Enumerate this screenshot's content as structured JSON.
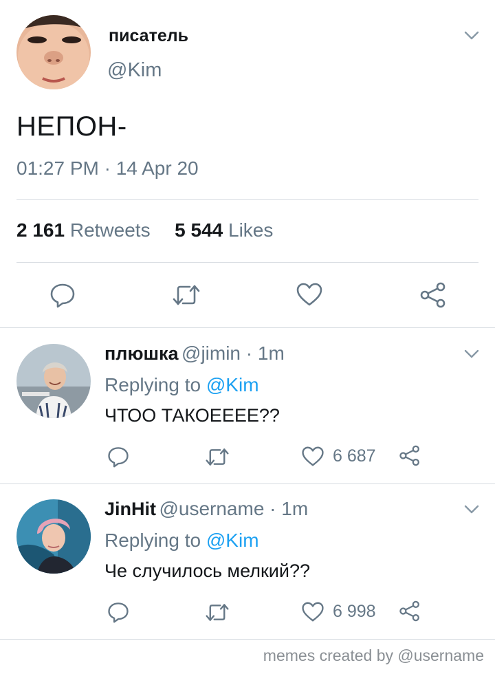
{
  "main_tweet": {
    "author_name": "писатель",
    "author_handle": "@Kim",
    "text": "НЕПОН-",
    "timestamp": "01:27 PM · 14 Apr 20",
    "retweets_count": "2 161",
    "retweets_label": "Retweets",
    "likes_count": "5 544",
    "likes_label": "Likes"
  },
  "replies": [
    {
      "author_name": "плюшка",
      "meta": "@jimin · 1m",
      "replying_prefix": "Replying to",
      "replying_mention": "@Kim",
      "text": "ЧТОО ТАКОЕЕЕЕ??",
      "likes": "6 687"
    },
    {
      "author_name": "JinHit",
      "meta": "@username · 1m",
      "replying_prefix": "Replying to",
      "replying_mention": "@Kim",
      "text": "Че случилось мелкий??",
      "likes": "6 998"
    }
  ],
  "footer": "memes created by @username",
  "colors": {
    "text": "#14171a",
    "secondary": "#657786",
    "link": "#1da1f2",
    "divider": "#d8dde2"
  },
  "icons": [
    "reply-icon",
    "retweet-icon",
    "like-icon",
    "share-icon",
    "chevron-down-icon"
  ]
}
